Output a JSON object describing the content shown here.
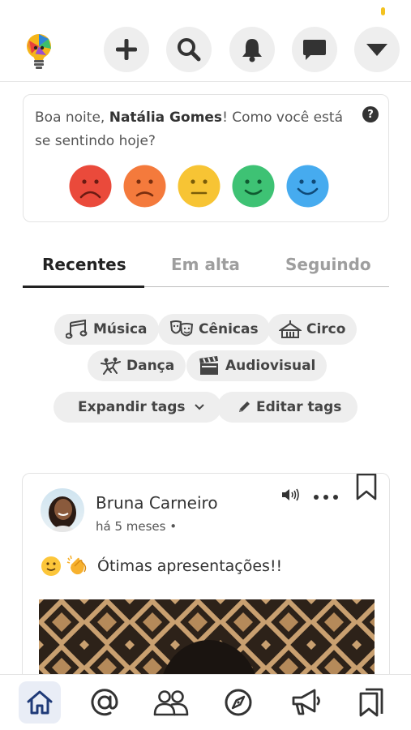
{
  "header": {
    "logo_icon": "lightbulb-logo-icon",
    "buttons": [
      {
        "icon": "plus-icon"
      },
      {
        "icon": "search-icon"
      },
      {
        "icon": "bell-icon"
      },
      {
        "icon": "chat-icon"
      },
      {
        "icon": "caret-down-icon"
      }
    ]
  },
  "mood": {
    "greeting_prefix": "Boa noite, ",
    "user_name": "Natália Gomes",
    "greeting_suffix": "! Como você está se sentindo hoje?",
    "help_label": "?",
    "faces": [
      {
        "icon": "very-sad-face-icon",
        "color": "#ea4a3b"
      },
      {
        "icon": "sad-face-icon",
        "color": "#f47a3c"
      },
      {
        "icon": "neutral-face-icon",
        "color": "#f7c434"
      },
      {
        "icon": "happy-face-icon",
        "color": "#3ec274"
      },
      {
        "icon": "very-happy-face-icon",
        "color": "#46abef"
      }
    ]
  },
  "tabs": [
    {
      "label": "Recentes",
      "active": true
    },
    {
      "label": "Em alta",
      "active": false
    },
    {
      "label": "Seguindo",
      "active": false
    }
  ],
  "tags": [
    {
      "label": "Música",
      "icon": "music-notes-icon"
    },
    {
      "label": "Cênicas",
      "icon": "theater-masks-icon"
    },
    {
      "label": "Circo",
      "icon": "circus-tent-icon"
    },
    {
      "label": "Dança",
      "icon": "dance-icon"
    },
    {
      "label": "Audiovisual",
      "icon": "clapperboard-icon"
    }
  ],
  "tag_actions": {
    "expand_label": "Expandir tags",
    "edit_label": "Editar tags"
  },
  "post": {
    "author": "Bruna Carneiro",
    "time": "há 5 meses •",
    "text": "Ótimas apresentações!!",
    "emojis": [
      "slightly-smiling-emoji",
      "clapping-hands-emoji"
    ]
  },
  "bottom_nav": [
    {
      "icon": "home-icon",
      "active": true
    },
    {
      "icon": "at-sign-icon",
      "active": false
    },
    {
      "icon": "people-icon",
      "active": false
    },
    {
      "icon": "compass-icon",
      "active": false
    },
    {
      "icon": "megaphone-icon",
      "active": false
    },
    {
      "icon": "bookmarks-icon",
      "active": false
    }
  ],
  "colors": {
    "accent_nav": "#1f3a78",
    "button_bg": "#eeeeee",
    "text_dark": "#333333",
    "text_muted": "#9e9e9e"
  }
}
